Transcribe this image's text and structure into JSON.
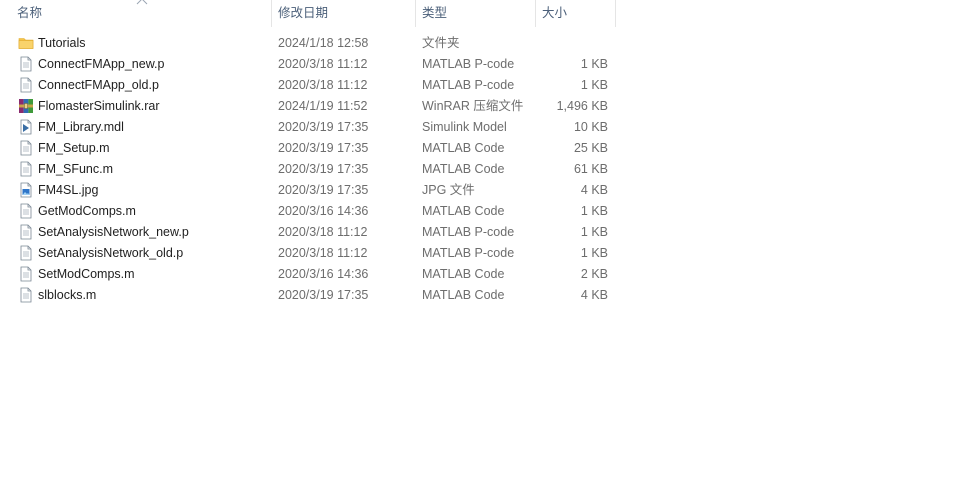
{
  "header": {
    "name": "名称",
    "date": "修改日期",
    "type": "类型",
    "size": "大小"
  },
  "colors": {
    "header_text": "#4c607a",
    "meta_text": "#6d6d6d",
    "folder": "#f6c54a"
  },
  "files": [
    {
      "name": "Tutorials",
      "date": "2024/1/18 12:58",
      "type": "文件夹",
      "size": "",
      "icon": "folder-icon"
    },
    {
      "name": "ConnectFMApp_new.p",
      "date": "2020/3/18 11:12",
      "type": "MATLAB P-code",
      "size": "1 KB",
      "icon": "document-icon"
    },
    {
      "name": "ConnectFMApp_old.p",
      "date": "2020/3/18 11:12",
      "type": "MATLAB P-code",
      "size": "1 KB",
      "icon": "document-icon"
    },
    {
      "name": "FlomasterSimulink.rar",
      "date": "2024/1/19 11:52",
      "type": "WinRAR 压缩文件",
      "size": "1,496 KB",
      "icon": "winrar-archive-icon"
    },
    {
      "name": "FM_Library.mdl",
      "date": "2020/3/19 17:35",
      "type": "Simulink Model",
      "size": "10 KB",
      "icon": "simulink-model-icon"
    },
    {
      "name": "FM_Setup.m",
      "date": "2020/3/19 17:35",
      "type": "MATLAB Code",
      "size": "25 KB",
      "icon": "document-icon"
    },
    {
      "name": "FM_SFunc.m",
      "date": "2020/3/19 17:35",
      "type": "MATLAB Code",
      "size": "61 KB",
      "icon": "document-icon"
    },
    {
      "name": "FM4SL.jpg",
      "date": "2020/3/19 17:35",
      "type": "JPG 文件",
      "size": "4 KB",
      "icon": "image-file-icon"
    },
    {
      "name": "GetModComps.m",
      "date": "2020/3/16 14:36",
      "type": "MATLAB Code",
      "size": "1 KB",
      "icon": "document-icon"
    },
    {
      "name": "SetAnalysisNetwork_new.p",
      "date": "2020/3/18 11:12",
      "type": "MATLAB P-code",
      "size": "1 KB",
      "icon": "document-icon"
    },
    {
      "name": "SetAnalysisNetwork_old.p",
      "date": "2020/3/18 11:12",
      "type": "MATLAB P-code",
      "size": "1 KB",
      "icon": "document-icon"
    },
    {
      "name": "SetModComps.m",
      "date": "2020/3/16 14:36",
      "type": "MATLAB Code",
      "size": "2 KB",
      "icon": "document-icon"
    },
    {
      "name": "slblocks.m",
      "date": "2020/3/19 17:35",
      "type": "MATLAB Code",
      "size": "4 KB",
      "icon": "document-icon"
    }
  ]
}
